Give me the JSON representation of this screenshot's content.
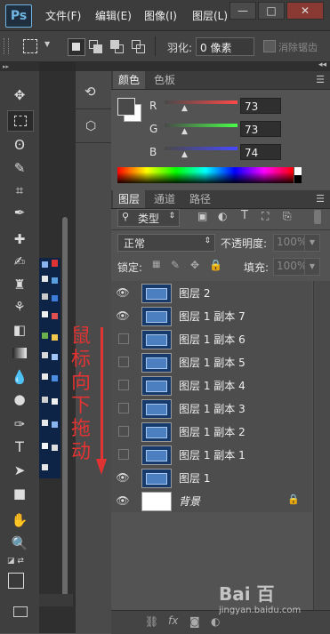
{
  "app": {
    "logo": "Ps"
  },
  "menubar": {
    "items": [
      "文件(F)",
      "编辑(E)",
      "图像(I)",
      "图层(L)"
    ],
    "window_buttons": [
      "—",
      "□",
      "✕"
    ]
  },
  "options": {
    "feather_label": "羽化:",
    "feather_value": "0 像素",
    "antialias_label": "消除锯齿"
  },
  "color_panel": {
    "tabs": [
      "颜色",
      "色板"
    ],
    "channels": [
      {
        "label": "R",
        "value": "73",
        "fraction": 0.29
      },
      {
        "label": "G",
        "value": "73",
        "fraction": 0.29
      },
      {
        "label": "B",
        "value": "74",
        "fraction": 0.29
      }
    ],
    "fg_color": "#494949"
  },
  "layers_panel": {
    "tabs": [
      "图层",
      "通道",
      "路径"
    ],
    "filter_kind": "类型",
    "blend_mode": "正常",
    "opacity_label": "不透明度:",
    "opacity_value": "100%",
    "lock_label": "锁定:",
    "fill_label": "填充:",
    "fill_value": "100%",
    "layers": [
      {
        "name": "图层 2",
        "visible": true
      },
      {
        "name": "图层 1 副本 7",
        "visible": true
      },
      {
        "name": "图层 1 副本 6",
        "visible": false
      },
      {
        "name": "图层 1 副本 5",
        "visible": false
      },
      {
        "name": "图层 1 副本 4",
        "visible": false
      },
      {
        "name": "图层 1 副本 3",
        "visible": false
      },
      {
        "name": "图层 1 副本 2",
        "visible": false
      },
      {
        "name": "图层 1 副本 1",
        "visible": false
      },
      {
        "name": "图层 1",
        "visible": true
      }
    ],
    "background_layer": {
      "name": "背景",
      "visible": true
    }
  },
  "annotation": {
    "text": [
      "鼠",
      "标",
      "向",
      "下",
      "拖",
      "动"
    ],
    "color": "#e23333"
  },
  "watermark": "Bai 百 jingyan.baidu.com"
}
